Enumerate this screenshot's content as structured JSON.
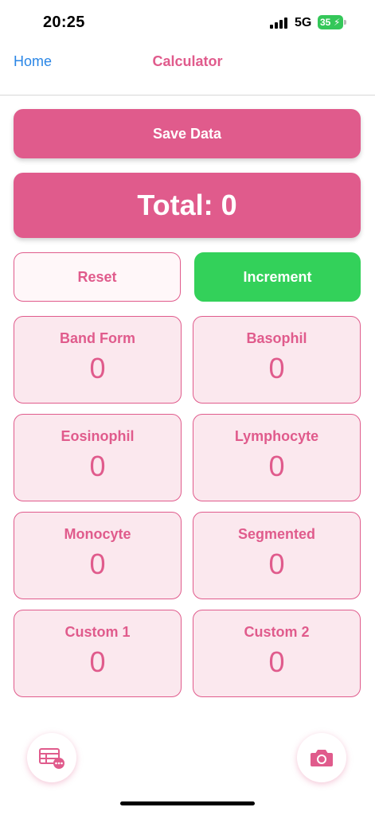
{
  "status_bar": {
    "time": "20:25",
    "network": "5G",
    "battery": "35"
  },
  "nav": {
    "back_label": "Home",
    "title": "Calculator"
  },
  "actions": {
    "save_label": "Save Data",
    "total_label": "Total: 0",
    "reset_label": "Reset",
    "increment_label": "Increment"
  },
  "cells": [
    {
      "label": "Band Form",
      "count": "0"
    },
    {
      "label": "Basophil",
      "count": "0"
    },
    {
      "label": "Eosinophil",
      "count": "0"
    },
    {
      "label": "Lymphocyte",
      "count": "0"
    },
    {
      "label": "Monocyte",
      "count": "0"
    },
    {
      "label": "Segmented",
      "count": "0"
    },
    {
      "label": "Custom 1",
      "count": "0"
    },
    {
      "label": "Custom 2",
      "count": "0"
    }
  ],
  "bottom": {
    "left_icon": "table-more-icon",
    "right_icon": "camera-icon"
  },
  "colors": {
    "accent": "#e05b8c",
    "increment": "#33d15a",
    "link": "#2a86e6",
    "card_bg": "#fbe8ee"
  }
}
